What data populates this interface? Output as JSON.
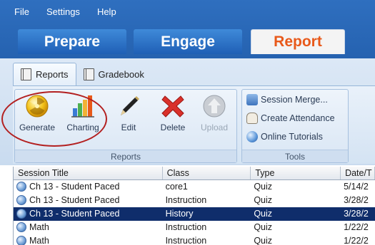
{
  "menu": [
    "File",
    "Settings",
    "Help"
  ],
  "big_tabs": [
    {
      "label": "Prepare",
      "active": false
    },
    {
      "label": "Engage",
      "active": false
    },
    {
      "label": "Report",
      "active": true
    }
  ],
  "sub_tabs": [
    {
      "label": "Reports",
      "active": true
    },
    {
      "label": "Gradebook",
      "active": false
    }
  ],
  "reports_group": {
    "title": "Reports",
    "buttons": [
      {
        "label": "Generate",
        "icon": "generate-icon",
        "enabled": true
      },
      {
        "label": "Charting",
        "icon": "bar-chart-icon",
        "enabled": true
      },
      {
        "label": "Edit",
        "icon": "pencil-icon",
        "enabled": true
      },
      {
        "label": "Delete",
        "icon": "red-x-icon",
        "enabled": true
      },
      {
        "label": "Upload",
        "icon": "upload-icon",
        "enabled": false
      }
    ]
  },
  "tools_group": {
    "title": "Tools",
    "items": [
      {
        "label": "Session Merge...",
        "icon": "merge-icon"
      },
      {
        "label": "Create Attendance",
        "icon": "hand-icon"
      },
      {
        "label": "Online Tutorials",
        "icon": "globe-icon"
      }
    ]
  },
  "table": {
    "columns": [
      "Session Title",
      "Class",
      "Type",
      "Date/T"
    ],
    "rows": [
      {
        "title": "Ch 13 - Student Paced",
        "class": "core1",
        "type": "Quiz",
        "date": "5/14/2",
        "selected": false
      },
      {
        "title": "Ch 13 - Student Paced",
        "class": "Instruction",
        "type": "Quiz",
        "date": "3/28/2",
        "selected": false
      },
      {
        "title": "Ch 13 - Student Paced",
        "class": "History",
        "type": "Quiz",
        "date": "3/28/2",
        "selected": true
      },
      {
        "title": "Math",
        "class": "Instruction",
        "type": "Quiz",
        "date": "1/22/2",
        "selected": false
      },
      {
        "title": "Math",
        "class": "Instruction",
        "type": "Quiz",
        "date": "1/22/2",
        "selected": false
      }
    ]
  },
  "colors": {
    "top_band": "#2f6fbf",
    "active_tab_text": "#e8591a",
    "selected_row": "#0f2d6b",
    "annotation_circle": "#b32020"
  }
}
